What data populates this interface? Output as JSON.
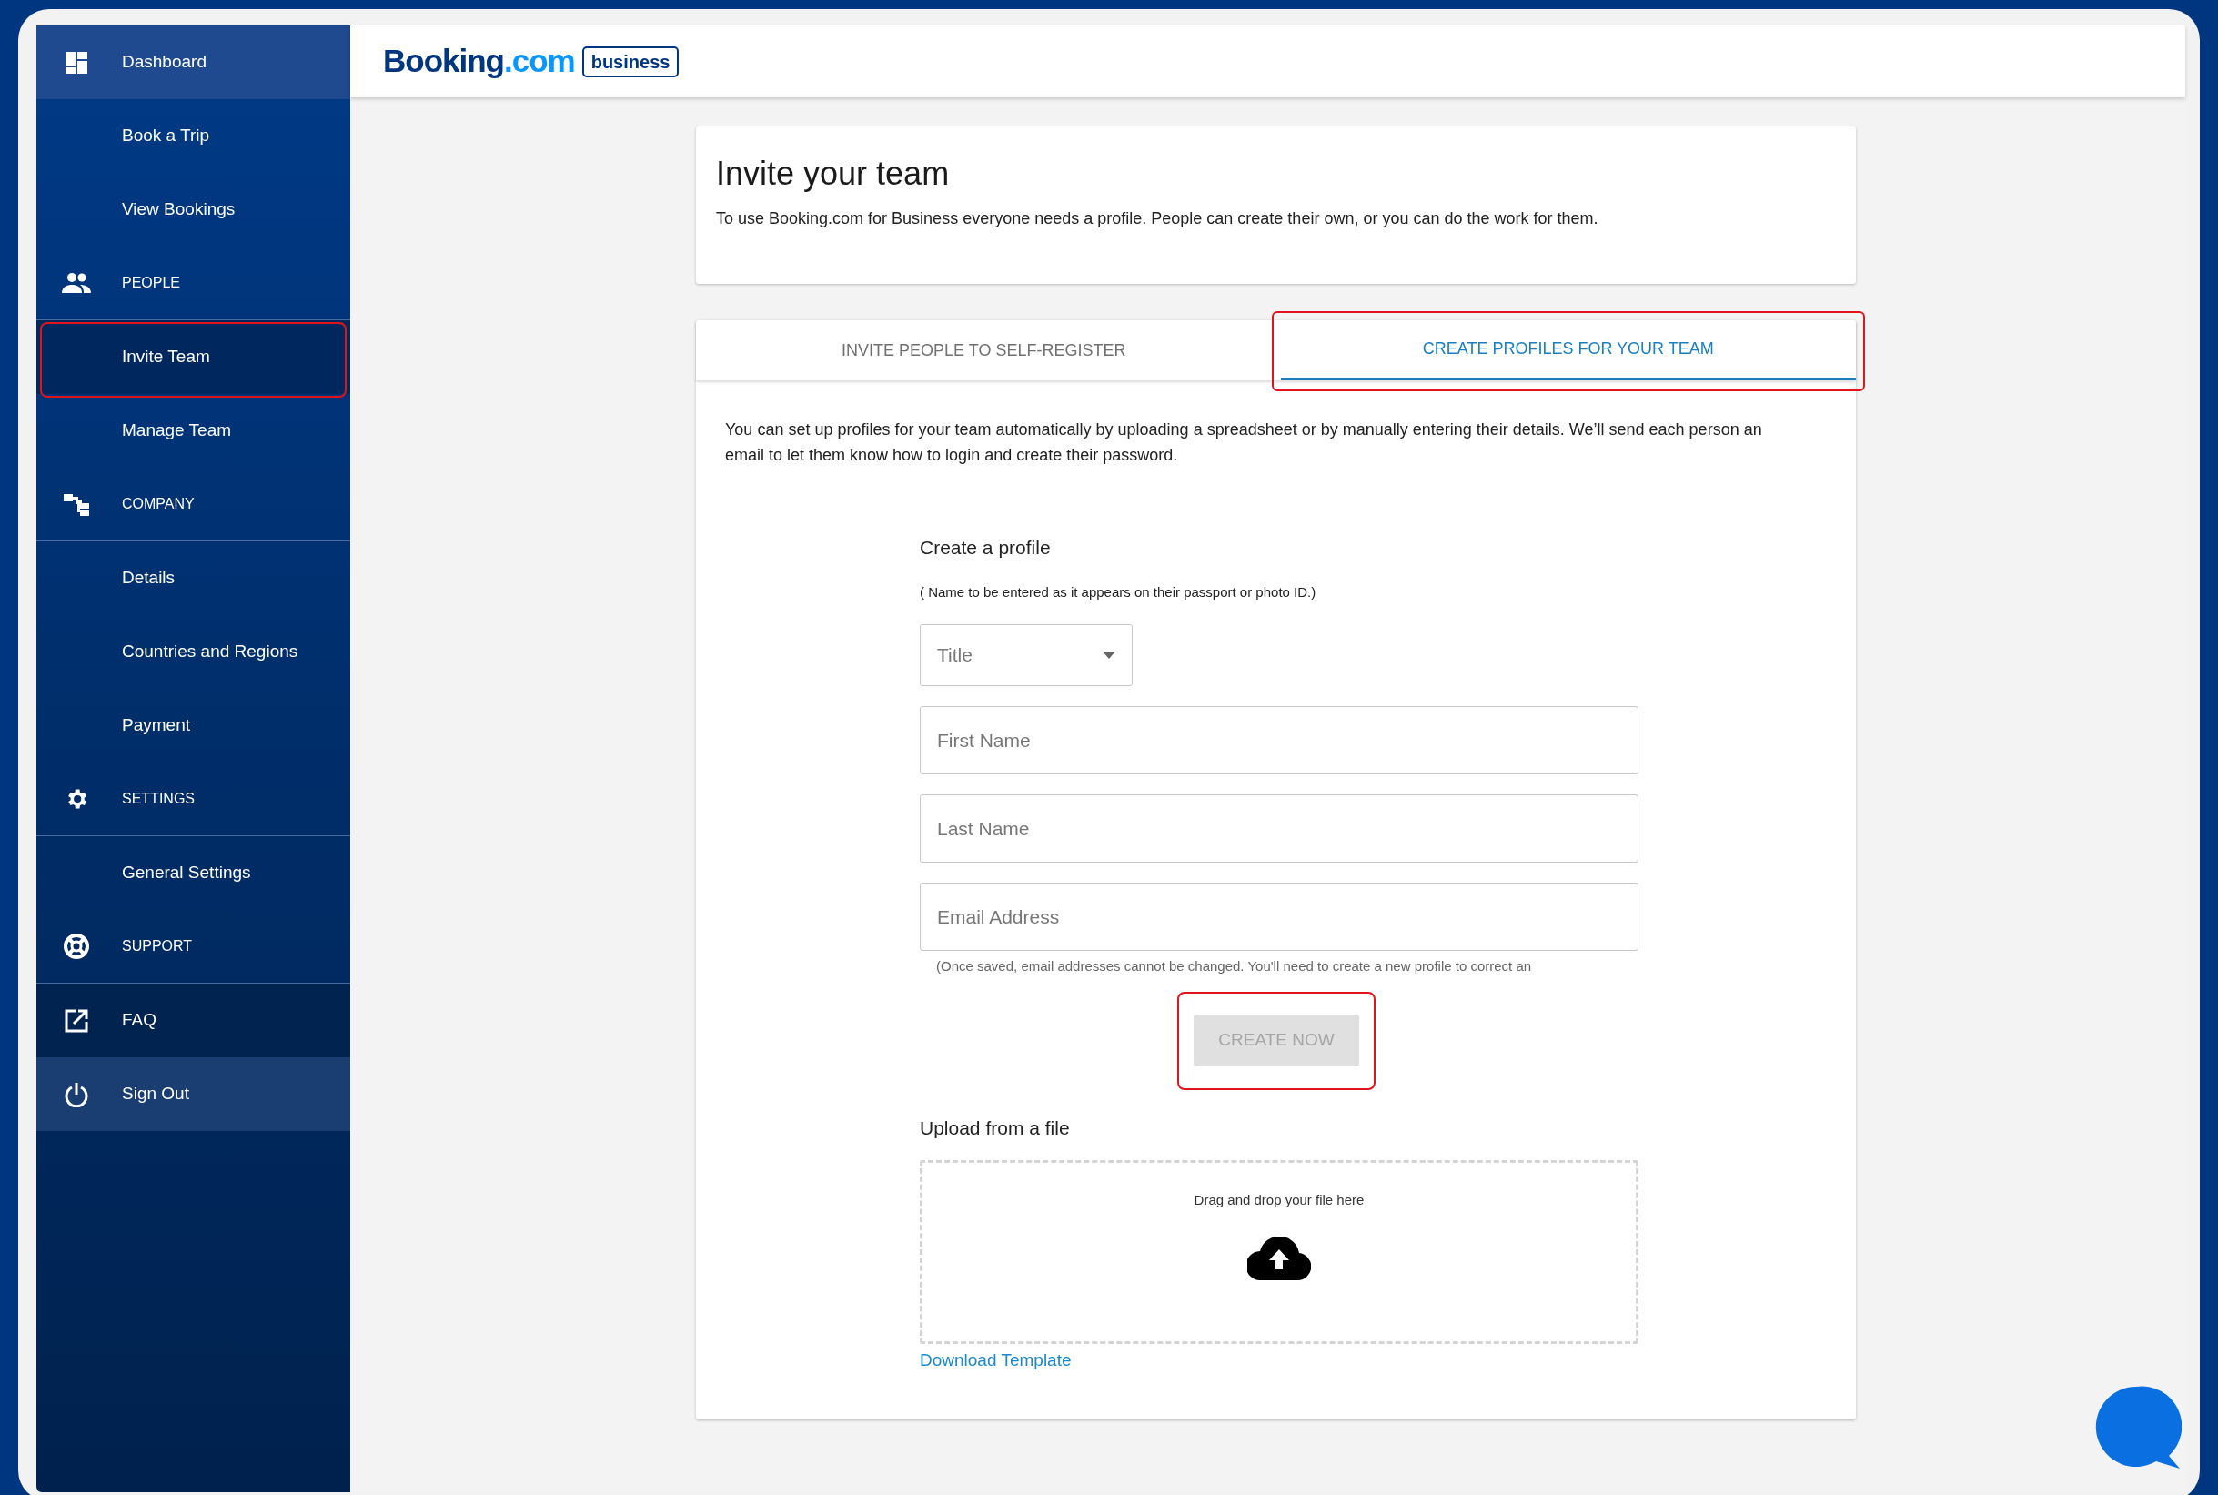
{
  "sidebar": {
    "items": [
      {
        "label": "Dashboard",
        "kind": "top",
        "selected": false
      },
      {
        "label": "Book a Trip",
        "kind": "item",
        "selected": false
      },
      {
        "label": "View Bookings",
        "kind": "item",
        "selected": false
      },
      {
        "label": "PEOPLE",
        "kind": "section",
        "selected": false
      },
      {
        "label": "Invite Team",
        "kind": "item",
        "selected": true,
        "highlighted": true
      },
      {
        "label": "Manage Team",
        "kind": "item",
        "selected": false
      },
      {
        "label": "COMPANY",
        "kind": "section",
        "selected": false
      },
      {
        "label": "Details",
        "kind": "item",
        "selected": false
      },
      {
        "label": "Countries and Regions",
        "kind": "item",
        "selected": false
      },
      {
        "label": "Payment",
        "kind": "item",
        "selected": false
      },
      {
        "label": "SETTINGS",
        "kind": "section",
        "selected": false
      },
      {
        "label": "General Settings",
        "kind": "item",
        "selected": false
      },
      {
        "label": "SUPPORT",
        "kind": "section",
        "selected": false
      },
      {
        "label": "FAQ",
        "kind": "link",
        "selected": false
      },
      {
        "label": "Sign Out",
        "kind": "action",
        "selected": false
      }
    ]
  },
  "header": {
    "wordmark": "Booking",
    "wordmark_accent": ".com",
    "badge": "business"
  },
  "intro": {
    "title": "Invite your team",
    "text": "To use Booking.com for Business everyone needs a profile. People can create their own, or you can do the work for them."
  },
  "tabs": [
    {
      "label": "INVITE PEOPLE TO SELF-REGISTER",
      "selected": false,
      "highlighted": false
    },
    {
      "label": "CREATE PROFILES FOR YOUR TEAM",
      "selected": true,
      "highlighted": true
    }
  ],
  "description": "You can set up profiles for your team automatically by uploading a spreadsheet or by manually entering their details. We’ll send each person an email to let them know how to login and create their password.",
  "form": {
    "heading": "Create a profile",
    "note": "( Name to be entered as it appears on their passport or photo ID.)",
    "title_select": {
      "placeholder": "Title"
    },
    "fields": [
      {
        "placeholder": "First Name"
      },
      {
        "placeholder": "Last Name"
      },
      {
        "placeholder": "Email Address"
      }
    ],
    "email_hint": "(Once saved, email addresses cannot be changed. You'll need to create a new profile to correct an",
    "submit": {
      "label": "CREATE NOW",
      "disabled": true,
      "highlighted": true
    }
  },
  "upload": {
    "heading": "Upload from a file",
    "dropzone_text": "Drag and drop your file here",
    "link": "Download Template"
  }
}
